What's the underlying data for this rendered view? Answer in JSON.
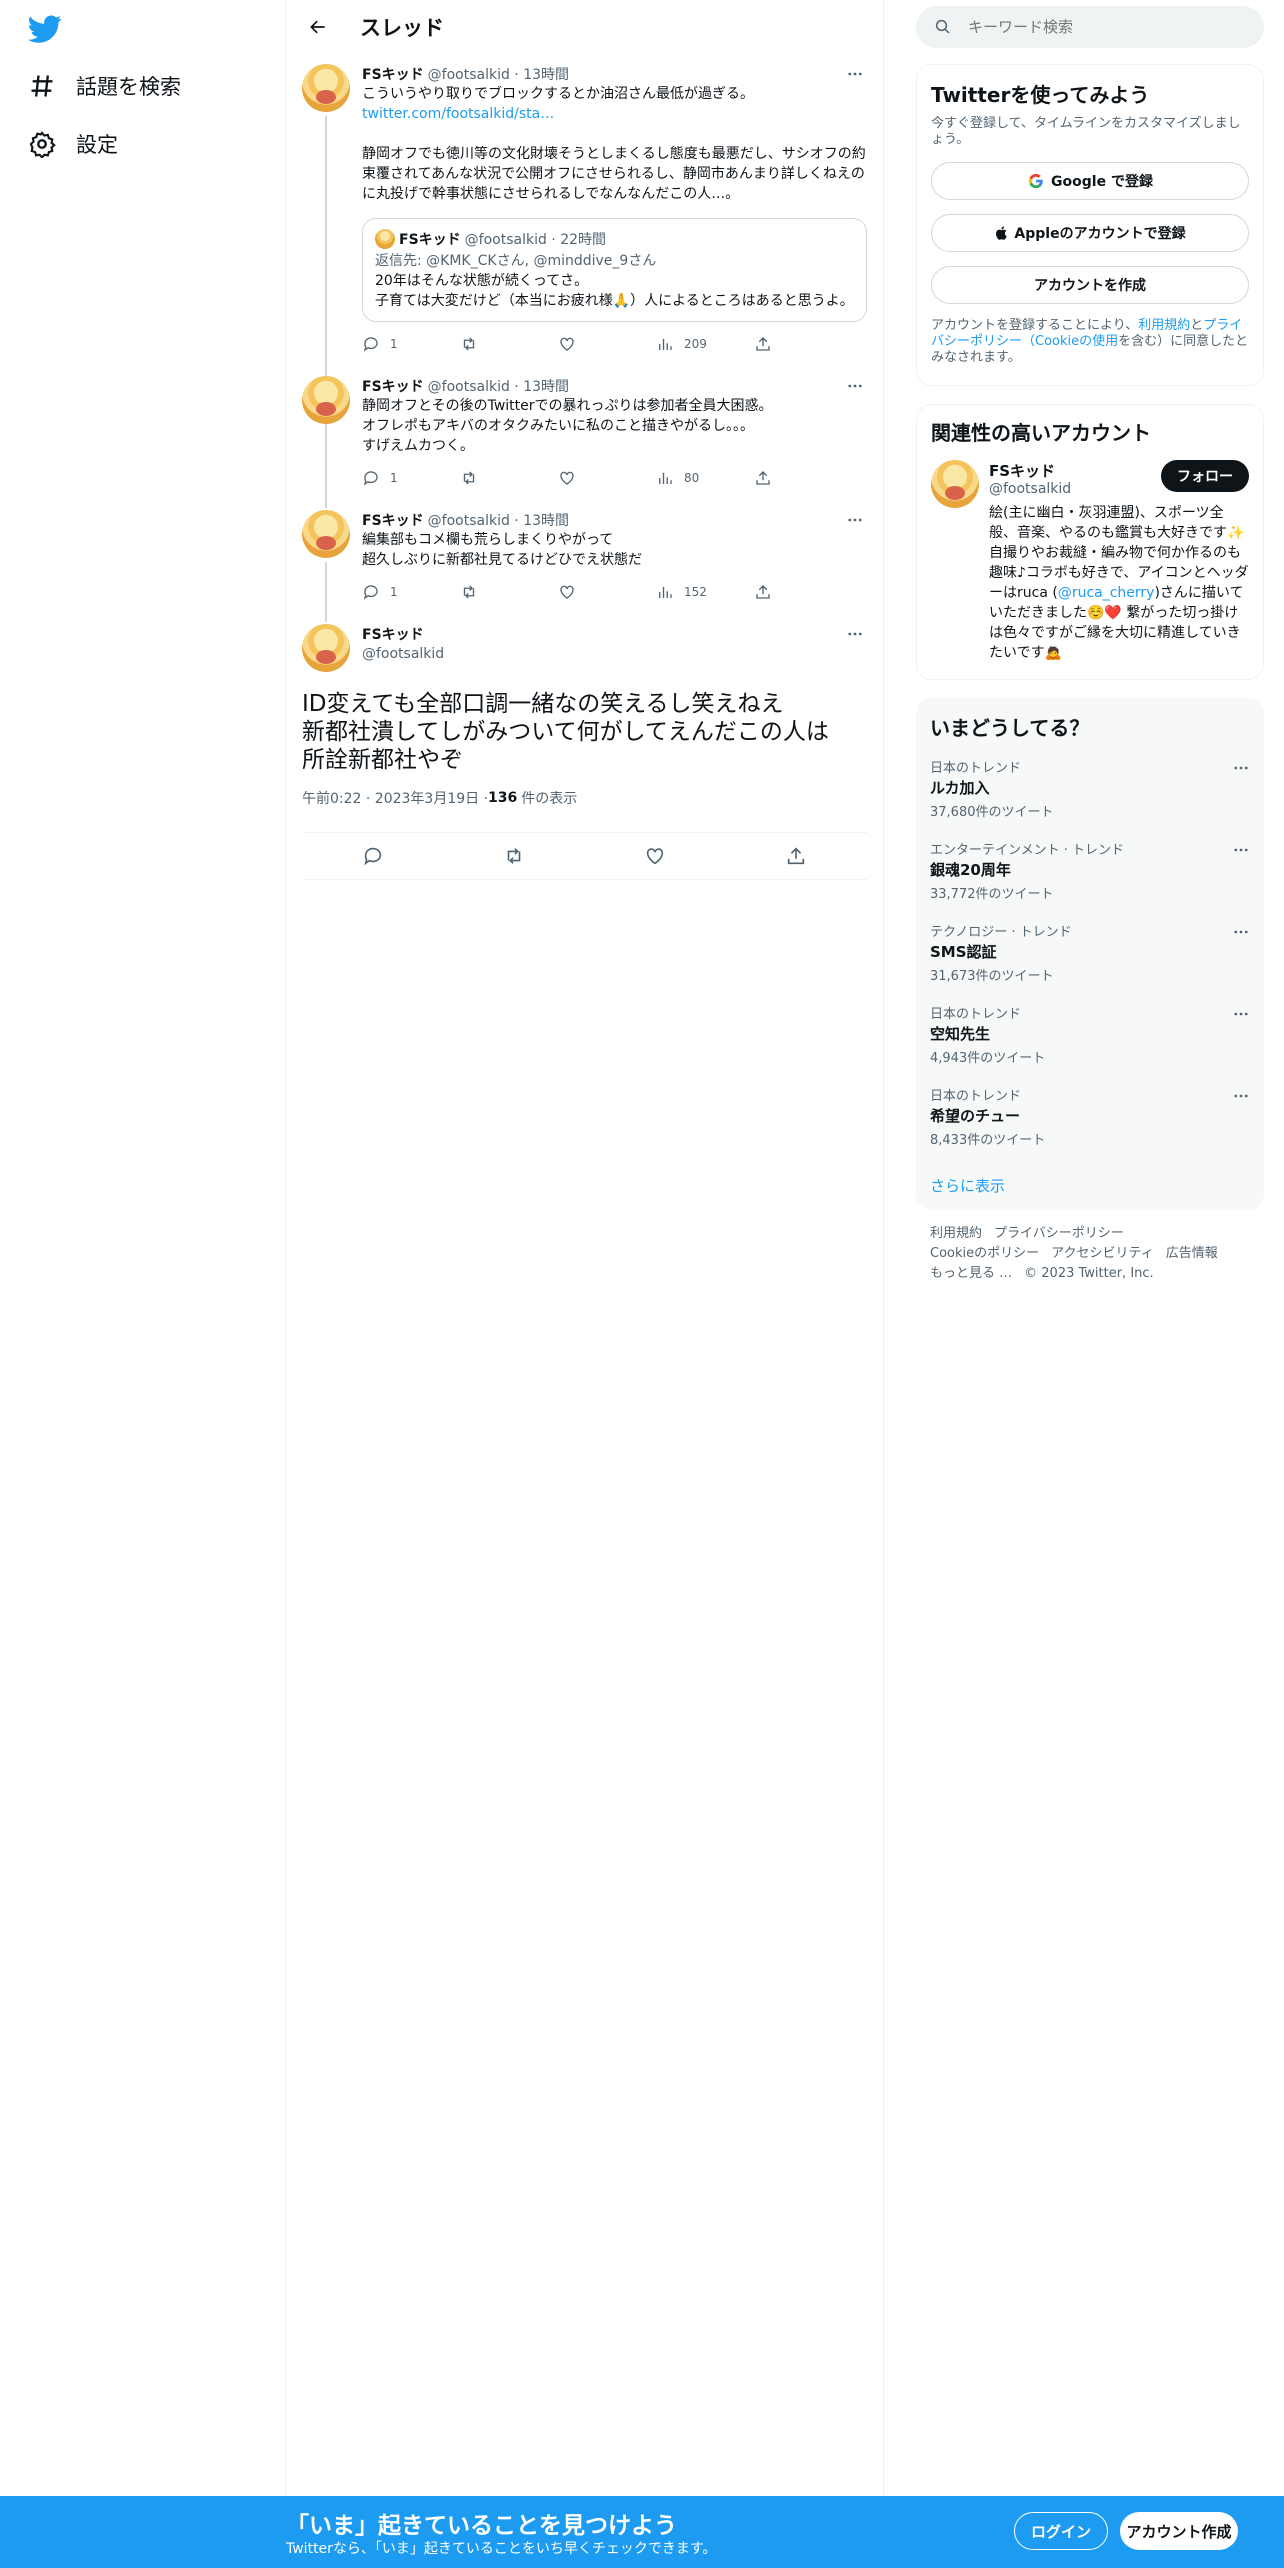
{
  "nav": {
    "explore": "話題を検索",
    "settings": "設定"
  },
  "header": {
    "title": "スレッド"
  },
  "tweets": [
    {
      "name": "FSキッド",
      "handle": "@footsalkid · 13時間",
      "text_line1": "こういうやり取りでブロックするとか油沼さん最低が過ぎる。",
      "link": "twitter.com/footsalkid/sta…",
      "text_rest": "静岡オフでも徳川等の文化財壊そうとしまくるし態度も最悪だし、サシオフの約束覆されてあんな状況で公開オフにさせられるし、静岡市あんまり詳しくねえのに丸投げで幹事状態にさせられるしでなんなんだこの人…。",
      "quote": {
        "name": "FSキッド",
        "handle": "@footsalkid · 22時間",
        "reply_to": "返信先: @KMK_CKさん, @minddive_9さん",
        "text": "20年はそんな状態が続くってさ。\n子育ては大変だけど（本当にお疲れ様🙏）人によるところはあると思うよ。"
      },
      "replies": "1",
      "views": "209"
    },
    {
      "name": "FSキッド",
      "handle": "@footsalkid · 13時間",
      "text": "静岡オフとその後のTwitterでの暴れっぷりは参加者全員大困惑。\nオフレポもアキバのオタクみたいに私のこと描きやがるし。。。\nすげえムカつく。",
      "replies": "1",
      "views": "80"
    },
    {
      "name": "FSキッド",
      "handle": "@footsalkid · 13時間",
      "text": "編集部もコメ欄も荒らしまくりやがって\n超久しぶりに新都社見てるけどひでえ状態だ",
      "replies": "1",
      "views": "152"
    }
  ],
  "focus": {
    "name": "FSキッド",
    "handle": "@footsalkid",
    "text": "ID変えても全部口調一緒なの笑えるし笑えねえ\n新都社潰してしがみついて何がしてえんだこの人は\n所詮新都社やぞ",
    "time": "午前0:22 · 2023年3月19日 · ",
    "views_count": "136",
    "views_label": "件の表示"
  },
  "search": {
    "placeholder": "キーワード検索"
  },
  "signup_card": {
    "title": "Twitterを使ってみよう",
    "subtitle": "今すぐ登録して、タイムラインをカスタマイズしましょう。",
    "google": "Google で登録",
    "apple": "Appleのアカウントで登録",
    "create": "アカウントを作成",
    "terms_pre": "アカウントを登録することにより、",
    "terms_link1": "利用規約",
    "terms_mid": "と",
    "terms_link2": "プライバシーポリシー（Cookieの使用",
    "terms_post": "を含む）に同意したとみなされます。"
  },
  "related": {
    "title": "関連性の高いアカウント",
    "name": "FSキッド",
    "handle": "@footsalkid",
    "follow": "フォロー",
    "bio_pre": "絵(主に幽白・灰羽連盟)、スポーツ全般、音楽、やるのも鑑賞も大好きです✨自撮りやお裁縫・編み物で何か作るのも趣味♪コラボも好きで、アイコンとヘッダーはruca (",
    "bio_link": "@ruca_cherry",
    "bio_post": ")さんに描いていただきました☺️❤️ 繋がった切っ掛けは色々ですがご縁を大切に精進していきたいです🙇"
  },
  "trends": {
    "title": "いまどうしてる？",
    "items": [
      {
        "cat": "日本のトレンド",
        "name": "ルカ加入",
        "count": "37,680件のツイート"
      },
      {
        "cat": "エンターテインメント · トレンド",
        "name": "銀魂20周年",
        "count": "33,772件のツイート"
      },
      {
        "cat": "テクノロジー · トレンド",
        "name": "SMS認証",
        "count": "31,673件のツイート"
      },
      {
        "cat": "日本のトレンド",
        "name": "空知先生",
        "count": "4,943件のツイート"
      },
      {
        "cat": "日本のトレンド",
        "name": "希望のチュー",
        "count": "8,433件のツイート"
      }
    ],
    "more": "さらに表示"
  },
  "footer": {
    "terms": "利用規約",
    "privacy": "プライバシーポリシー",
    "cookie": "Cookieのポリシー",
    "accessibility": "アクセシビリティ",
    "ads": "広告情報",
    "more": "もっと見る …",
    "copyright": "© 2023 Twitter, Inc."
  },
  "bottom": {
    "title": "「いま」起きていることを見つけよう",
    "subtitle": "Twitterなら、「いま」起きていることをいち早くチェックできます。",
    "login": "ログイン",
    "signup": "アカウント作成"
  }
}
